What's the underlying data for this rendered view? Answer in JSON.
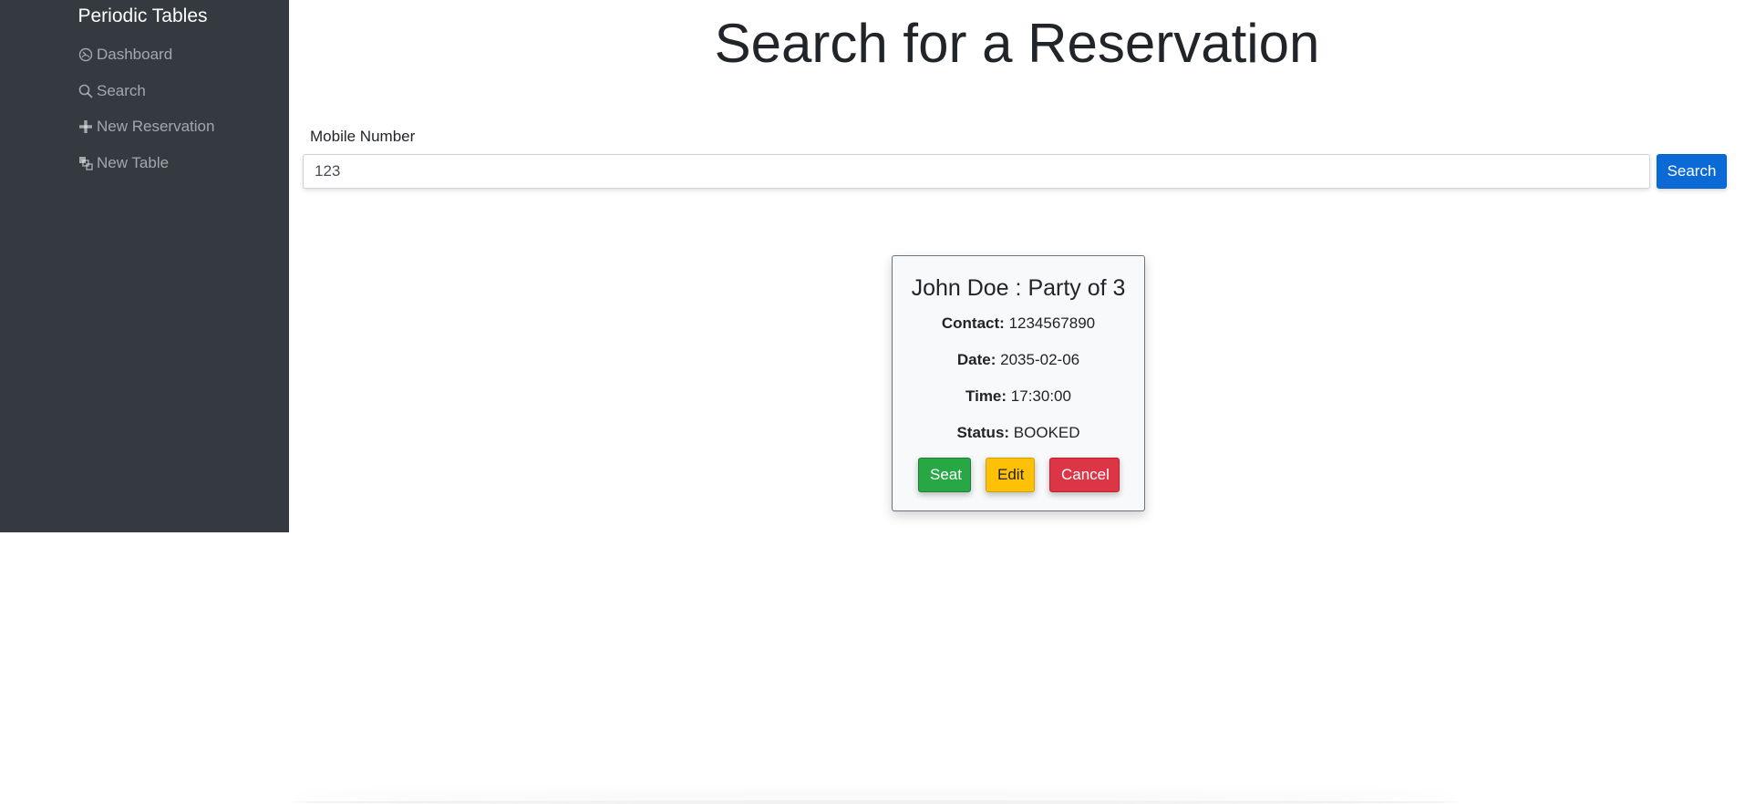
{
  "sidebar": {
    "brand": "Periodic Tables",
    "items": [
      {
        "label": "Dashboard",
        "icon": "dashboard-icon"
      },
      {
        "label": "Search",
        "icon": "search-icon"
      },
      {
        "label": "New Reservation",
        "icon": "plus-icon"
      },
      {
        "label": "New Table",
        "icon": "table-icon"
      }
    ]
  },
  "main": {
    "title": "Search for a Reservation",
    "search": {
      "label": "Mobile Number",
      "value": "123",
      "button_label": "Search"
    },
    "reservation": {
      "name": "John Doe",
      "separator": " : ",
      "party": "Party of 3",
      "contact_label": "Contact:",
      "contact": "1234567890",
      "date_label": "Date:",
      "date": "2035-02-06",
      "time_label": "Time:",
      "time": "17:30:00",
      "status_label": "Status:",
      "status": "BOOKED",
      "actions": {
        "seat": "Seat",
        "edit": "Edit",
        "cancel": "Cancel"
      }
    }
  },
  "colors": {
    "sidebar_bg": "#343a40",
    "primary": "#0b6ad6",
    "success": "#28a745",
    "warning": "#ffc107",
    "danger": "#dc3545"
  }
}
